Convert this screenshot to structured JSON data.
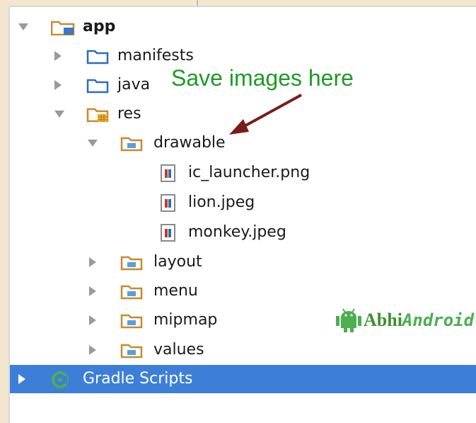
{
  "tree": {
    "app": "app",
    "manifests": "manifests",
    "java": "java",
    "res": "res",
    "drawable": "drawable",
    "files": [
      "ic_launcher.png",
      "lion.jpeg",
      "monkey.jpeg"
    ],
    "layout": "layout",
    "menu": "menu",
    "mipmap": "mipmap",
    "values": "values",
    "gradle": "Gradle Scripts"
  },
  "annotation": {
    "text": "Save images here",
    "color": "#1f9a27",
    "arrow_color": "#7a1c1c"
  },
  "brand": {
    "abhi": "Abhi",
    "android": "Android"
  },
  "colors": {
    "selection": "#3d7fd8",
    "folder_blue": "#2c6fb7",
    "folder_orange": "#c98a2a",
    "file_red": "#c0392b"
  },
  "icons": {
    "module": "app-module-icon",
    "folder": "folder-icon",
    "res_folder": "res-folder-icon",
    "package": "package-folder-icon",
    "image_file": "image-file-icon",
    "gradle": "gradle-icon",
    "brand": "android-robot-icon"
  }
}
